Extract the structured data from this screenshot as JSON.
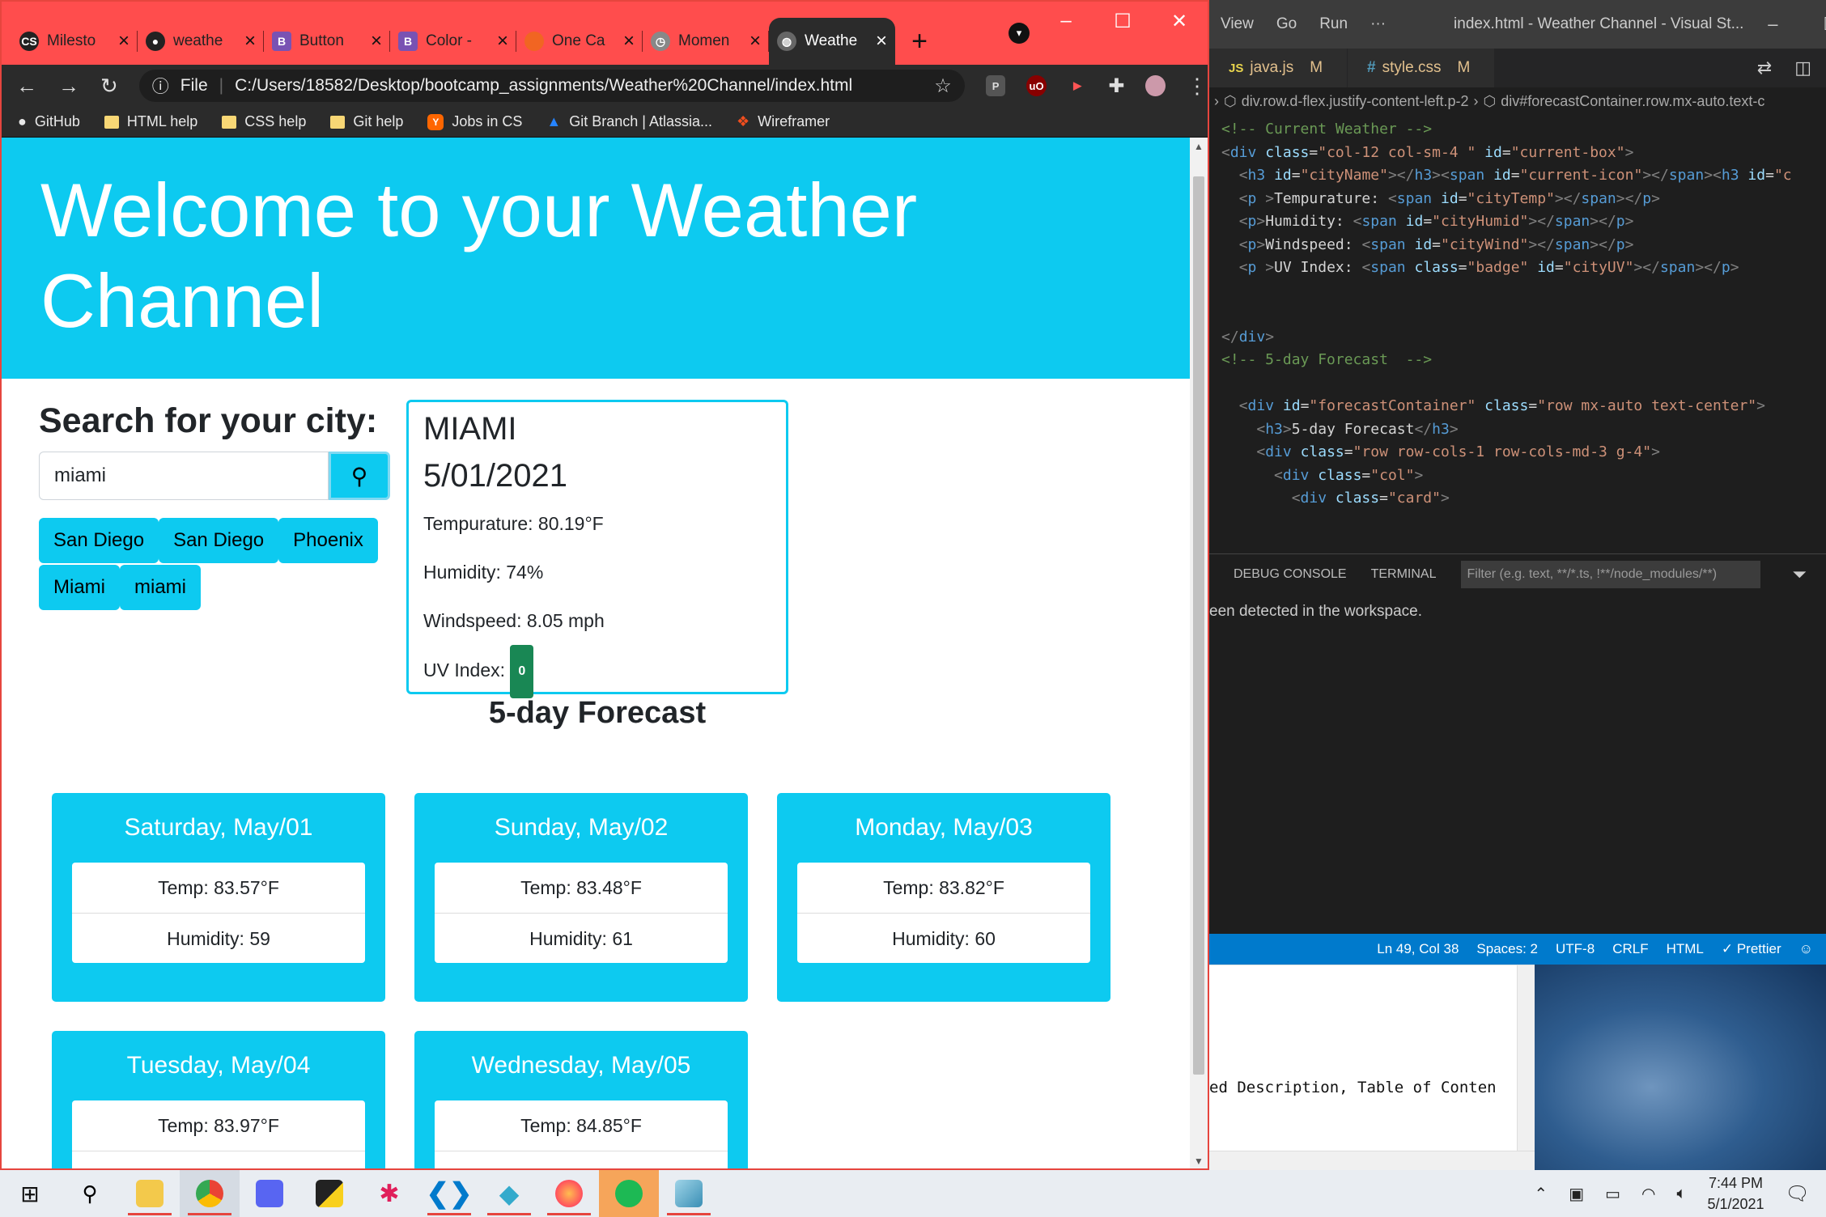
{
  "chrome": {
    "tabs": [
      {
        "title": "Milesto",
        "fav": "CS",
        "color": "#222"
      },
      {
        "title": "weathe",
        "fav": "GH",
        "color": "#222"
      },
      {
        "title": "Button",
        "fav": "B",
        "color": "#7952b3"
      },
      {
        "title": "Color -",
        "fav": "B",
        "color": "#7952b3"
      },
      {
        "title": "One Ca",
        "fav": "O",
        "color": "#f16522"
      },
      {
        "title": "Momen",
        "fav": "M",
        "color": "#888"
      },
      {
        "title": "Weathe",
        "fav": "W",
        "color": "#888"
      }
    ],
    "new_tab": "+",
    "address_scheme": "File",
    "url": "C:/Users/18582/Desktop/bootcamp_assignments/Weather%20Channel/index.html",
    "bookmarks": [
      {
        "label": "GitHub",
        "icon": "github-icon"
      },
      {
        "label": "HTML help",
        "icon": "folder-icon"
      },
      {
        "label": "CSS help",
        "icon": "folder-icon"
      },
      {
        "label": "Git help",
        "icon": "folder-icon"
      },
      {
        "label": "Jobs in CS",
        "icon": "ycombinator-icon"
      },
      {
        "label": "Git Branch | Atlassia...",
        "icon": "atlassian-icon"
      },
      {
        "label": "Wireframer",
        "icon": "figma-icon"
      }
    ]
  },
  "page": {
    "heading": "Welcome to your Weather Channel",
    "search_title": "Search for your city:",
    "search_value": "miami",
    "history": [
      "San Diego",
      "San Diego",
      "Phoenix",
      "Miami",
      "miami"
    ],
    "current": {
      "city": "MIAMI",
      "date": "5/01/2021",
      "temp_label": "Tempurature: 80.19°F",
      "humidity_label": "Humidity: 74%",
      "wind_label": "Windspeed: 8.05 mph",
      "uv_label": "UV Index:",
      "uv_value": "0",
      "uv_color": "#198754"
    },
    "forecast_title": "5-day Forecast",
    "forecast": [
      {
        "day": "Saturday, May/01",
        "temp": "Temp: 83.57°F",
        "humidity": "Humidity: 59"
      },
      {
        "day": "Sunday, May/02",
        "temp": "Temp: 83.48°F",
        "humidity": "Humidity: 61"
      },
      {
        "day": "Monday, May/03",
        "temp": "Temp: 83.82°F",
        "humidity": "Humidity: 60"
      },
      {
        "day": "Tuesday, May/04",
        "temp": "Temp: 83.97°F",
        "humidity": ""
      },
      {
        "day": "Wednesday, May/05",
        "temp": "Temp: 84.85°F",
        "humidity": ""
      }
    ],
    "accent": "#0dcaf0"
  },
  "vscode": {
    "menu": [
      "View",
      "Go",
      "Run",
      "···"
    ],
    "window_title": "index.html - Weather Channel - Visual St...",
    "tabs": [
      {
        "icon": "JS",
        "name": "java.js",
        "mark": "M"
      },
      {
        "icon": "#",
        "name": "style.css",
        "mark": "M"
      }
    ],
    "breadcrumb_1": "div.row.d-flex.justify-content-left.p-2",
    "breadcrumb_2": "div#forecastContainer.row.mx-auto.text-c",
    "panel_tabs": [
      "DEBUG CONSOLE",
      "TERMINAL"
    ],
    "filter_placeholder": "Filter (e.g. text, **/*.ts, !**/node_modules/**)",
    "panel_message": "een detected in the workspace.",
    "status": [
      "Ln 49, Col 38",
      "Spaces: 2",
      "UTF-8",
      "CRLF",
      "HTML",
      "✓ Prettier"
    ],
    "lower_text": "ed Description, Table of Conten"
  },
  "taskbar": {
    "time": "7:44 PM",
    "date": "5/1/2021"
  }
}
